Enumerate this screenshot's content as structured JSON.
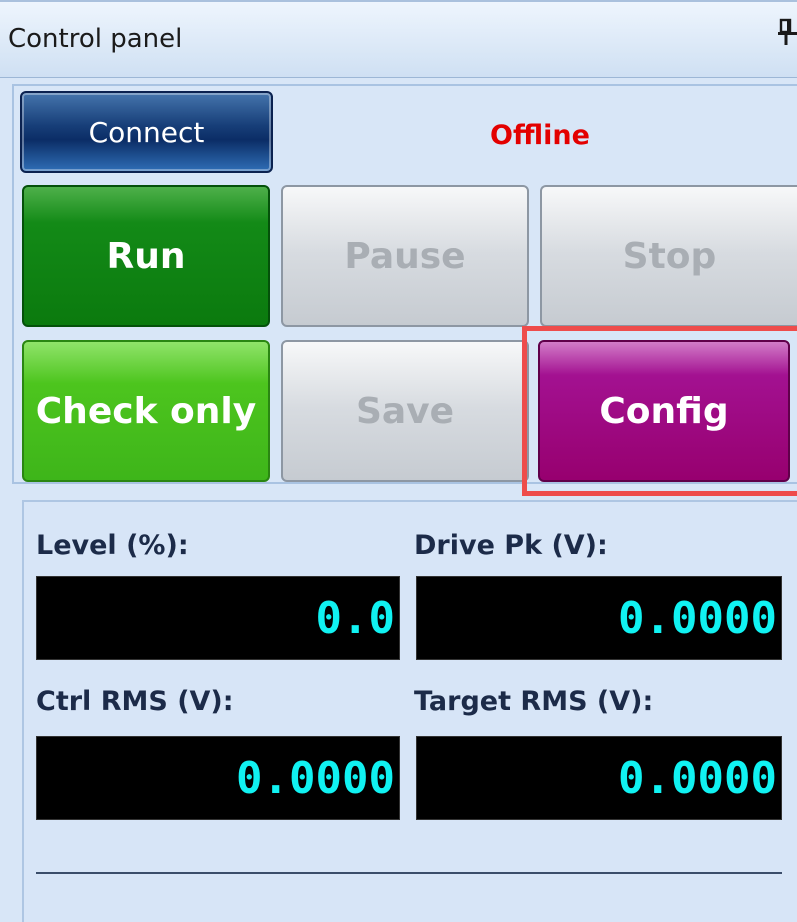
{
  "title": "Control panel",
  "icons": {
    "pin": "pin-icon"
  },
  "connect_label": "Connect",
  "status": {
    "text": "Offline",
    "color": "#e30000"
  },
  "buttons": {
    "run": "Run",
    "pause": "Pause",
    "stop": "Stop",
    "check_only": "Check only",
    "save": "Save",
    "config": "Config"
  },
  "readouts": {
    "level": {
      "label": "Level (%):",
      "value": "0.0"
    },
    "drive_pk": {
      "label": "Drive Pk (V):",
      "value": "0.0000"
    },
    "ctrl_rms": {
      "label": "Ctrl RMS (V):",
      "value": "0.0000"
    },
    "target_rms": {
      "label": "Target RMS (V):",
      "value": "0.0000"
    }
  },
  "colors": {
    "run": "#0b7a0e",
    "check_only": "#3eb51a",
    "config": "#97006f",
    "connect": "#0b2d66",
    "readout_text": "#10f2f2",
    "highlight": "#ee4c4b"
  }
}
